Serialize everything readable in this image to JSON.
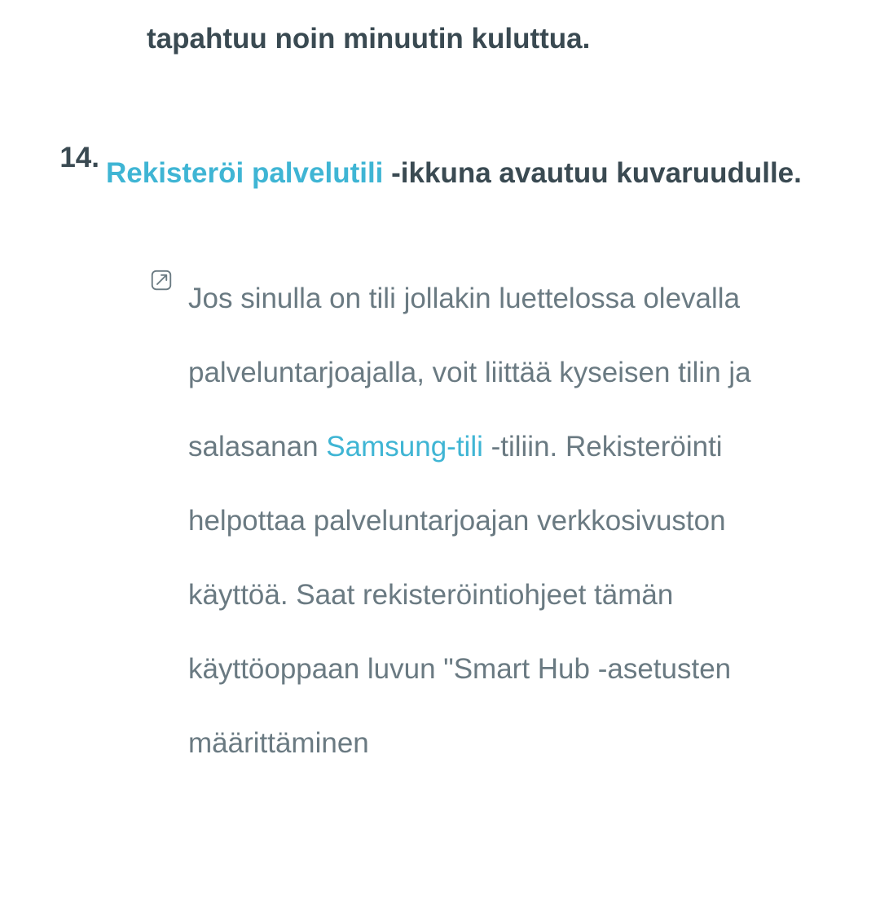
{
  "prev_text": "tapahtuu noin minuutin kuluttua.",
  "item14": {
    "number": "14.",
    "highlight": "Rekisteröi palvelutili",
    "rest": " -ikkuna avautuu kuvaruudulle."
  },
  "note": {
    "part1": "Jos sinulla on tili jollakin luettelossa olevalla palveluntarjoajalla, voit liittää kyseisen tilin ja salasanan ",
    "highlight": "Samsung-tili",
    "part2": " -tiliin. Rekisteröinti helpottaa palveluntarjoajan verkkosivuston käyttöä. Saat rekisteröintiohjeet tämän käyttöoppaan luvun \"Smart Hub -asetusten määrittäminen"
  }
}
